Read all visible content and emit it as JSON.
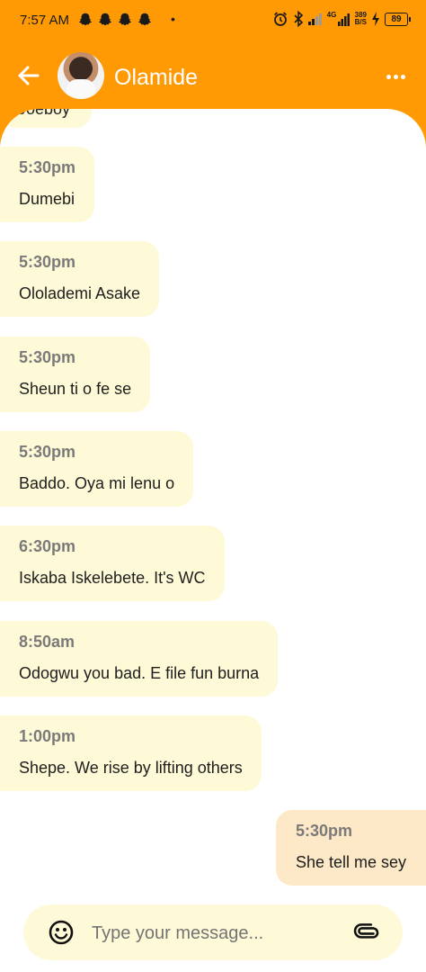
{
  "status_bar": {
    "time": "7:57 AM",
    "notification_icons": [
      "snapchat-icon",
      "snapchat-icon",
      "snapchat-icon",
      "snapchat-icon"
    ],
    "dot": "•",
    "speed_value": "389",
    "speed_unit": "B/S",
    "network_label": "4G",
    "battery": "89"
  },
  "header": {
    "contact_name": "Olamide",
    "back_icon": "arrow-left-icon",
    "menu_icon": "more-horizontal-icon",
    "background_color": "#ff9a05"
  },
  "messages": {
    "partial_text": "Joeboy",
    "items": [
      {
        "time": "5:30pm",
        "text": "Dumebi",
        "direction": "received"
      },
      {
        "time": "5:30pm",
        "text": "Ololademi Asake",
        "direction": "received"
      },
      {
        "time": "5:30pm",
        "text": "Sheun ti o fe se",
        "direction": "received"
      },
      {
        "time": "5:30pm",
        "text": "Baddo. Oya mi lenu o",
        "direction": "received"
      },
      {
        "time": "6:30pm",
        "text": "Iskaba Iskelebete. It's WC",
        "direction": "received"
      },
      {
        "time": "8:50am",
        "text": "Odogwu you bad. E file fun burna",
        "direction": "received"
      },
      {
        "time": "1:00pm",
        "text": "Shepe. We rise by lifting others",
        "direction": "received"
      },
      {
        "time": "5:30pm",
        "text": "She tell me sey",
        "direction": "sent"
      }
    ],
    "received_color": "#fef9d6",
    "sent_color": "#fde9c7"
  },
  "composer": {
    "placeholder": "Type your message...",
    "emoji_icon": "smiley-icon",
    "attach_icon": "paperclip-icon"
  }
}
